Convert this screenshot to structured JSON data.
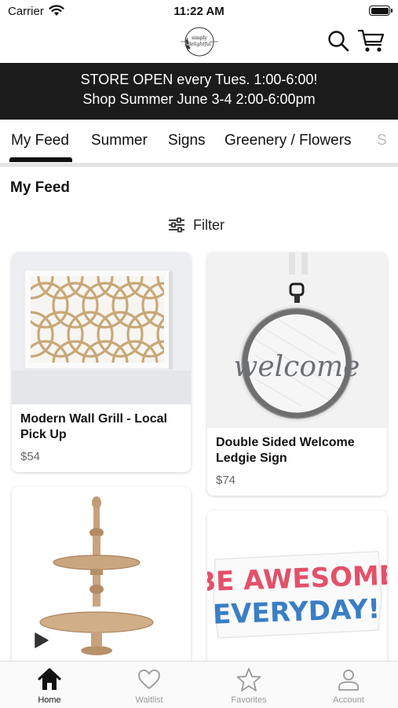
{
  "status_bar": {
    "carrier": "Carrier",
    "time": "11:22 AM"
  },
  "header": {
    "logo_text": "simply delightful"
  },
  "banner": {
    "line1": "STORE OPEN every Tues. 1:00-6:00!",
    "line2": "Shop Summer June 3-4 2:00-6:00pm"
  },
  "tabs": [
    "My Feed",
    "Summer",
    "Signs",
    "Greenery / Flowers",
    "S"
  ],
  "active_tab": "My Feed",
  "feed_title": "My Feed",
  "filter_label": "Filter",
  "products": [
    {
      "name": "Modern Wall Grill - Local Pick Up",
      "price": "$54"
    },
    {
      "name": "Double Sided Welcome Ledgie Sign",
      "price": "$74"
    },
    {
      "name": "",
      "price": ""
    },
    {
      "name": "",
      "price": ""
    }
  ],
  "product_art": {
    "welcome_text": "welcome",
    "sign_line1": "BE AWESOME",
    "sign_line2": "EVERYDAY!"
  },
  "bottom_nav": [
    {
      "label": "Home",
      "icon": "home-icon",
      "active": true
    },
    {
      "label": "Waitlist",
      "icon": "heart-icon",
      "active": false
    },
    {
      "label": "Favorites",
      "icon": "star-icon",
      "active": false
    },
    {
      "label": "Account",
      "icon": "person-icon",
      "active": false
    }
  ],
  "colors": {
    "banner_bg": "#1b1b1b",
    "text": "#111111",
    "muted": "#999999"
  }
}
